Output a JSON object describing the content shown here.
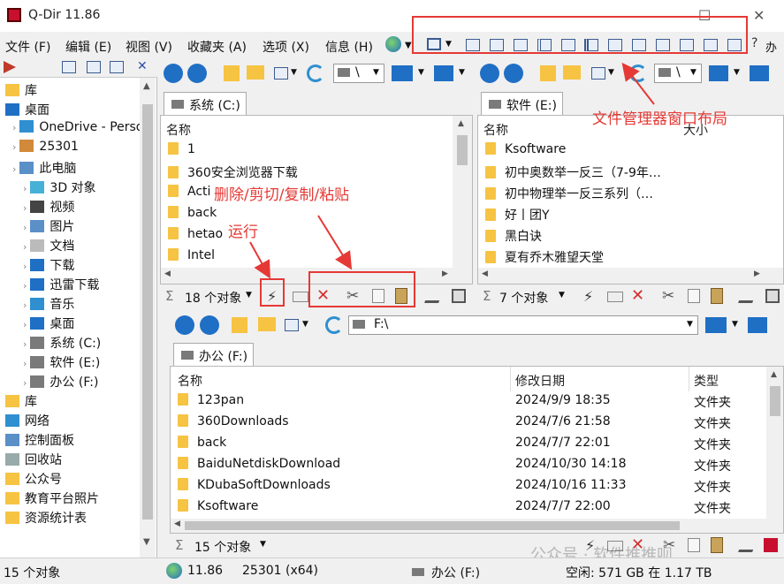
{
  "window": {
    "title": "Q-Dir 11.86",
    "minimize": "—",
    "maximize": "☐",
    "close": "✕"
  },
  "menu": [
    "文件 (F)",
    "编辑 (E)",
    "视图 (V)",
    "收藏夹 (A)",
    "选项 (X)",
    "信息 (H)"
  ],
  "menu_extra": "办公",
  "annotations": {
    "layout": "文件管理器窗口布局",
    "edit": "删除/剪切/复制/粘贴",
    "run": "运行"
  },
  "tree": [
    {
      "label": "库",
      "indent": 0,
      "icon": "library-icon"
    },
    {
      "label": "桌面",
      "indent": 0,
      "icon": "desktop-icon"
    },
    {
      "label": "OneDrive - Perso",
      "indent": 1,
      "icon": "cloud-icon"
    },
    {
      "label": "25301",
      "indent": 1,
      "icon": "user-icon"
    },
    {
      "label": "此电脑",
      "indent": 1,
      "icon": "computer-icon"
    },
    {
      "label": "3D 对象",
      "indent": 2,
      "icon": "cube-icon"
    },
    {
      "label": "视频",
      "indent": 2,
      "icon": "video-icon"
    },
    {
      "label": "图片",
      "indent": 2,
      "icon": "picture-icon"
    },
    {
      "label": "文档",
      "indent": 2,
      "icon": "document-icon"
    },
    {
      "label": "下载",
      "indent": 2,
      "icon": "download-icon"
    },
    {
      "label": "迅雷下载",
      "indent": 2,
      "icon": "thunder-icon"
    },
    {
      "label": "音乐",
      "indent": 2,
      "icon": "music-icon"
    },
    {
      "label": "桌面",
      "indent": 2,
      "icon": "desktop-icon"
    },
    {
      "label": "系统 (C:)",
      "indent": 2,
      "icon": "drive-icon"
    },
    {
      "label": "软件 (E:)",
      "indent": 2,
      "icon": "drive-icon"
    },
    {
      "label": "办公 (F:)",
      "indent": 2,
      "icon": "drive-icon"
    },
    {
      "label": "库",
      "indent": 0,
      "icon": "library-icon"
    },
    {
      "label": "网络",
      "indent": 0,
      "icon": "network-icon"
    },
    {
      "label": "控制面板",
      "indent": 0,
      "icon": "control-panel-icon"
    },
    {
      "label": "回收站",
      "indent": 0,
      "icon": "recycle-bin-icon"
    },
    {
      "label": "公众号",
      "indent": 0,
      "icon": "folder-icon"
    },
    {
      "label": "教育平台照片",
      "indent": 0,
      "icon": "folder-icon"
    },
    {
      "label": "资源统计表",
      "indent": 0,
      "icon": "folder-icon"
    }
  ],
  "pane1": {
    "address": "\\",
    "tab": "系统 (C:)",
    "header": "名称",
    "rows": [
      "1",
      "360安全浏览器下载",
      "Acti",
      "back",
      "hetao",
      "Intel"
    ],
    "status": "18 个对象"
  },
  "pane2": {
    "address": "\\",
    "tab": "软件 (E:)",
    "header": "名称",
    "header2": "大小",
    "rows": [
      "Ksoftware",
      "初中奥数举一反三（7-9年…",
      "初中物理举一反三系列（…",
      "好丨团Y",
      "黑白诀",
      "夏有乔木雅望天堂"
    ],
    "status": "7 个对象"
  },
  "pane3": {
    "address": "F:\\",
    "tab": "办公 (F:)",
    "headers": [
      "名称",
      "修改日期",
      "类型"
    ],
    "rows": [
      [
        "123pan",
        "2024/9/9 18:35",
        "文件夹"
      ],
      [
        "360Downloads",
        "2024/7/6 21:58",
        "文件夹"
      ],
      [
        "back",
        "2024/7/7 22:01",
        "文件夹"
      ],
      [
        "BaiduNetdiskDownload",
        "2024/10/30 14:18",
        "文件夹"
      ],
      [
        "KDubaSoftDownloads",
        "2024/10/16 11:33",
        "文件夹"
      ],
      [
        "Ksoftware",
        "2024/7/7 22:00",
        "文件夹"
      ]
    ],
    "status": "15 个对象"
  },
  "statusbar": {
    "left": "15 个对象",
    "version": "11.86",
    "build": "25301 (x64)",
    "drive": "办公 (F:)",
    "space": "空闲: 571 GB 在 1.17 TB"
  },
  "watermark": "公众号 · 软件推推呗",
  "colors": {
    "annotation": "#e53935",
    "folder": "#f6c343",
    "accent": "#1f6fc5",
    "delete": "#d32f2f"
  }
}
